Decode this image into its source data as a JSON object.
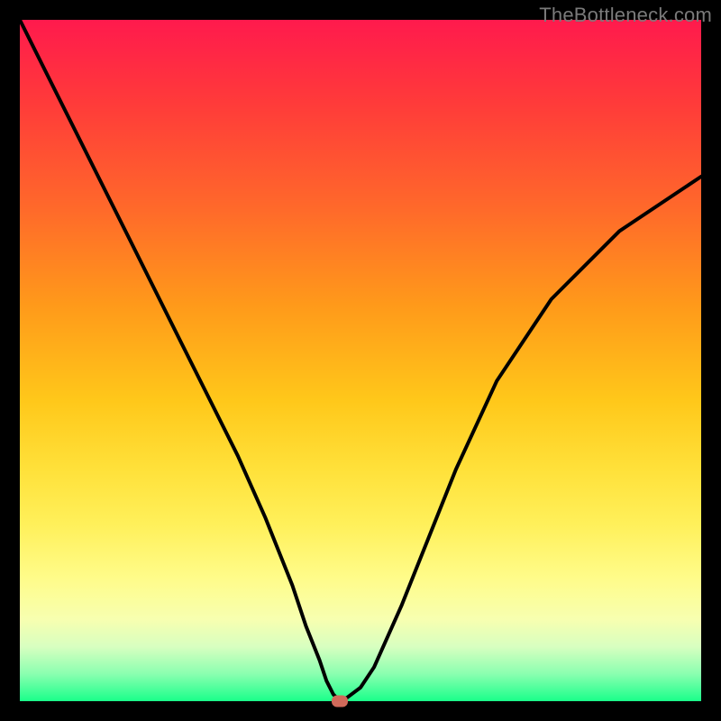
{
  "watermark": "TheBottleneck.com",
  "chart_data": {
    "type": "line",
    "title": "",
    "xlabel": "",
    "ylabel": "",
    "xlim": [
      0,
      100
    ],
    "ylim": [
      0,
      100
    ],
    "grid": false,
    "legend": false,
    "series": [
      {
        "name": "bottleneck-curve",
        "x": [
          0,
          4,
          8,
          12,
          16,
          20,
          24,
          28,
          32,
          36,
          40,
          42,
          44,
          45,
          46,
          47,
          48,
          50,
          52,
          56,
          60,
          64,
          70,
          78,
          88,
          100
        ],
        "y": [
          100,
          92,
          84,
          76,
          68,
          60,
          52,
          44,
          36,
          27,
          17,
          11,
          6,
          3,
          1,
          0,
          0.5,
          2,
          5,
          14,
          24,
          34,
          47,
          59,
          69,
          77
        ]
      }
    ],
    "marker": {
      "name": "optimal-point",
      "x": 47,
      "y": 0,
      "color": "#d06a5a"
    },
    "background_gradient": {
      "top": "#ff1a4d",
      "middle": "#ffe13a",
      "bottom": "#1aff8a"
    }
  }
}
